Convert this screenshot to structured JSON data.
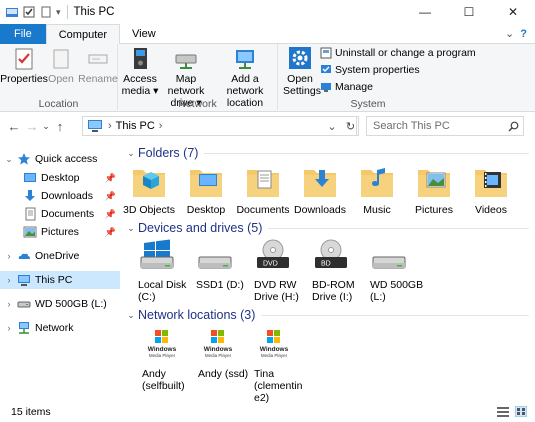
{
  "window": {
    "title": "This PC",
    "controls": {
      "minimize": "—",
      "maximize": "☐",
      "close": "✕"
    }
  },
  "ribbon": {
    "tabs": [
      "File",
      "Computer",
      "View"
    ],
    "groups": {
      "location": {
        "label": "Location",
        "buttons": [
          "Properties",
          "Open",
          "Rename"
        ]
      },
      "network": {
        "label": "Network",
        "buttons": [
          "Access media ▾",
          "Map network drive ▾",
          "Add a network location"
        ]
      },
      "system": {
        "label": "System",
        "open_settings": "Open Settings",
        "small": [
          "Uninstall or change a program",
          "System properties",
          "Manage"
        ]
      }
    }
  },
  "address": {
    "path": "This PC",
    "separator": "›",
    "search_placeholder": "Search This PC"
  },
  "sidebar": {
    "items": [
      {
        "label": "Quick access",
        "icon": "star-icon",
        "pinned": false
      },
      {
        "label": "Desktop",
        "icon": "desktop-icon",
        "pinned": true
      },
      {
        "label": "Downloads",
        "icon": "downloads-icon",
        "pinned": true
      },
      {
        "label": "Documents",
        "icon": "documents-icon",
        "pinned": true
      },
      {
        "label": "Pictures",
        "icon": "pictures-icon",
        "pinned": true
      },
      {
        "label": "OneDrive",
        "icon": "onedrive-icon"
      },
      {
        "label": "This PC",
        "icon": "computer-icon",
        "selected": true
      },
      {
        "label": "WD 500GB (L:)",
        "icon": "drive-icon"
      },
      {
        "label": "Network",
        "icon": "network-icon"
      }
    ]
  },
  "sections": {
    "folders": {
      "title": "Folders (7)",
      "items": [
        "3D Objects",
        "Desktop",
        "Documents",
        "Downloads",
        "Music",
        "Pictures",
        "Videos"
      ]
    },
    "drives": {
      "title": "Devices and drives (5)",
      "items": [
        {
          "line1": "Local Disk",
          "line2": "(C:)"
        },
        {
          "line1": "SSD1 (D:)",
          "line2": ""
        },
        {
          "line1": "DVD RW",
          "line2": "Drive (H:)"
        },
        {
          "line1": "BD-ROM",
          "line2": "Drive (I:)"
        },
        {
          "line1": "WD 500GB",
          "line2": "(L:)"
        }
      ],
      "disc_labels": [
        "DVD",
        "BD"
      ]
    },
    "network": {
      "title": "Network locations (3)",
      "items": [
        {
          "lines": [
            "Andy",
            "(selfbuilt)"
          ]
        },
        {
          "lines": [
            "Andy (ssd)"
          ]
        },
        {
          "lines": [
            "Tina",
            "(clementin",
            "e2)"
          ]
        }
      ],
      "logo_text": [
        "Windows",
        "Media Player"
      ]
    }
  },
  "status": {
    "count": "15 items"
  },
  "colors": {
    "accent": "#1979ca",
    "selected": "#cce8ff",
    "section_title": "#1e3287",
    "folder": "#f5c86a"
  }
}
